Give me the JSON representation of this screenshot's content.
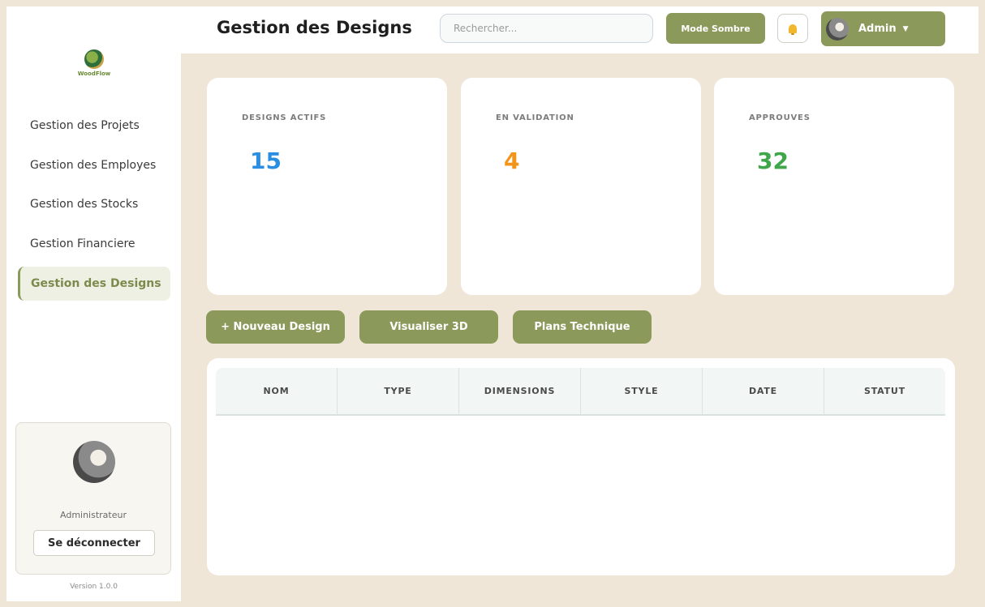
{
  "app": {
    "logo_text": "WoodFlow",
    "version": "Version 1.0.0"
  },
  "header": {
    "title": "Gestion des Designs",
    "search_placeholder": "Rechercher...",
    "dark_mode_label": "Mode Sombre",
    "admin_label": "Admin",
    "admin_caret": "▼"
  },
  "sidebar": {
    "items": [
      {
        "label": "Gestion des Projets"
      },
      {
        "label": "Gestion des Employes"
      },
      {
        "label": "Gestion des Stocks"
      },
      {
        "label": "Gestion Financiere"
      },
      {
        "label": "Gestion des Designs",
        "active": true
      }
    ],
    "user": {
      "role": "Administrateur",
      "logout_label": "Se déconnecter"
    }
  },
  "stats": [
    {
      "label": "DESIGNS ACTIFS",
      "value": "15",
      "color": "#2a8fe3"
    },
    {
      "label": "EN VALIDATION",
      "value": "4",
      "color": "#f39418"
    },
    {
      "label": "APPROUVES",
      "value": "32",
      "color": "#3fa64a"
    }
  ],
  "actions": [
    {
      "label": "+ Nouveau Design"
    },
    {
      "label": "Visualiser 3D"
    },
    {
      "label": "Plans Technique"
    }
  ],
  "table": {
    "columns": [
      "NOM",
      "TYPE",
      "DIMENSIONS",
      "STYLE",
      "DATE",
      "STATUT"
    ],
    "rows": []
  },
  "colors": {
    "accent": "#8b9a5b",
    "background": "#efe6d8"
  }
}
